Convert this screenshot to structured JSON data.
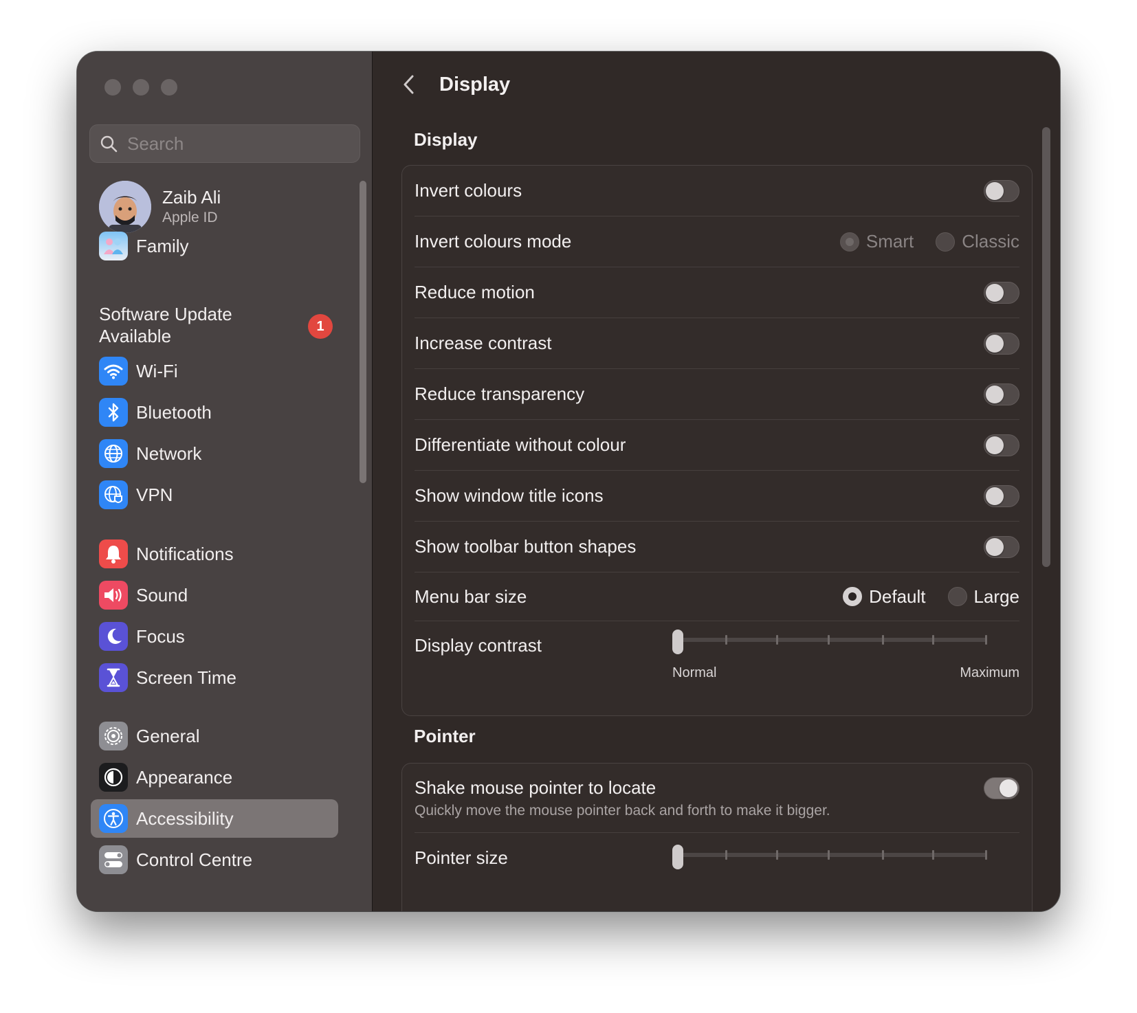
{
  "sidebar": {
    "search_placeholder": "Search",
    "profile": {
      "name": "Zaib Ali",
      "subtitle": "Apple ID"
    },
    "family_label": "Family",
    "update": {
      "line1": "Software Update",
      "line2": "Available",
      "badge_count": "1"
    },
    "items": [
      {
        "label": "Wi-Fi",
        "icon": "wifi-icon",
        "color": "#2f86f6"
      },
      {
        "label": "Bluetooth",
        "icon": "bluetooth-icon",
        "color": "#2f86f6"
      },
      {
        "label": "Network",
        "icon": "globe-icon",
        "color": "#2f86f6"
      },
      {
        "label": "VPN",
        "icon": "vpn-globe-icon",
        "color": "#2f86f6"
      },
      {
        "label": "Notifications",
        "icon": "bell-icon",
        "color": "#ee4c4a"
      },
      {
        "label": "Sound",
        "icon": "speaker-icon",
        "color": "#ee4a62"
      },
      {
        "label": "Focus",
        "icon": "moon-icon",
        "color": "#5a52d6"
      },
      {
        "label": "Screen Time",
        "icon": "hourglass-icon",
        "color": "#5a52d6"
      },
      {
        "label": "General",
        "icon": "gear-icon",
        "color": "#8e8e93"
      },
      {
        "label": "Appearance",
        "icon": "appearance-icon",
        "color": "#1c1c1e"
      },
      {
        "label": "Accessibility",
        "icon": "accessibility-icon",
        "color": "#2f86f6",
        "active": true
      },
      {
        "label": "Control Centre",
        "icon": "control-centre-icon",
        "color": "#8e8e93"
      }
    ]
  },
  "main": {
    "title": "Display",
    "display_section": {
      "title": "Display",
      "rows": {
        "invert_colours": {
          "label": "Invert colours",
          "on": false
        },
        "invert_mode": {
          "label": "Invert colours mode",
          "options": [
            "Smart",
            "Classic"
          ],
          "selected": "Smart",
          "disabled": true
        },
        "reduce_motion": {
          "label": "Reduce motion",
          "on": false
        },
        "increase_contrast": {
          "label": "Increase contrast",
          "on": false
        },
        "reduce_transparency": {
          "label": "Reduce transparency",
          "on": false
        },
        "differentiate": {
          "label": "Differentiate without colour",
          "on": false
        },
        "title_icons": {
          "label": "Show window title icons",
          "on": false
        },
        "toolbar_shapes": {
          "label": "Show toolbar button shapes",
          "on": false
        },
        "menu_bar_size": {
          "label": "Menu bar size",
          "options": [
            "Default",
            "Large"
          ],
          "selected": "Default"
        },
        "display_contrast": {
          "label": "Display contrast",
          "min_label": "Normal",
          "max_label": "Maximum",
          "value": 0
        }
      }
    },
    "pointer_section": {
      "title": "Pointer",
      "shake": {
        "label": "Shake mouse pointer to locate",
        "description": "Quickly move the mouse pointer back and forth to make it bigger.",
        "on": true
      },
      "pointer_size": {
        "label": "Pointer size",
        "value": 0
      }
    }
  }
}
